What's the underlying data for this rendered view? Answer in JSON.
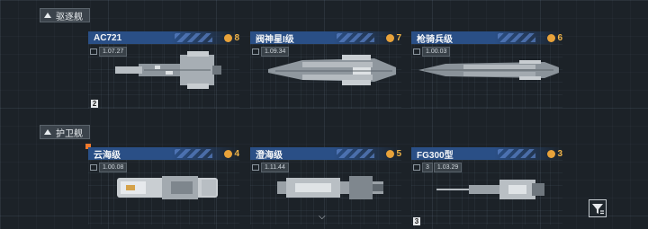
{
  "sections": {
    "destroyers": {
      "label": "驱逐舰"
    },
    "frigates": {
      "label": "护卫舰"
    }
  },
  "cards": {
    "ac721": {
      "name": "AC721",
      "level": "8",
      "count": "",
      "stat": "1.07.27"
    },
    "judgment": {
      "name": "阀神星I级",
      "level": "7",
      "count": "",
      "stat": "1.09.34"
    },
    "lancer": {
      "name": "枪骑兵级",
      "level": "6",
      "count": "",
      "stat": "1.00.03"
    },
    "cloudsea": {
      "name": "云海级",
      "level": "4",
      "count": "",
      "stat": "1.00.08"
    },
    "clearsea": {
      "name": "澄海级",
      "level": "5",
      "count": "",
      "stat": "1.11.44"
    },
    "fg300": {
      "name": "FG300型",
      "level": "3",
      "count": "3",
      "stat": "1.03.29"
    }
  },
  "badges": {
    "ac721_count": "2",
    "fg300_count": "3"
  },
  "colors": {
    "accent": "#2a4f86",
    "level": "#f1b54a"
  },
  "icons": {
    "filter": "filter-icon",
    "scroll": "chevron-down-icon"
  }
}
